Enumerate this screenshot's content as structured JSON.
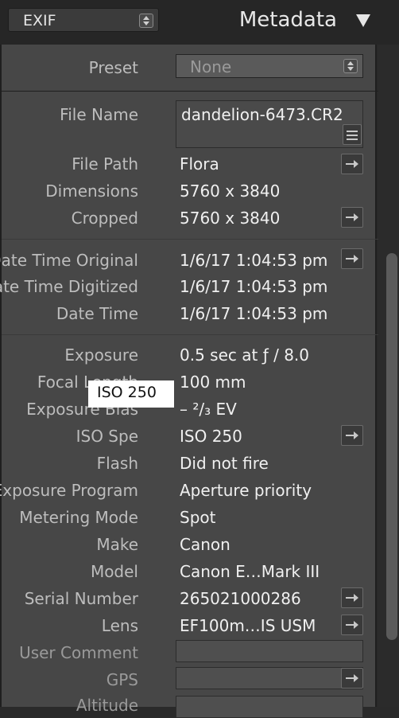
{
  "header": {
    "preset_select": "EXIF",
    "title": "Metadata"
  },
  "preset": {
    "label": "Preset",
    "value": "None"
  },
  "file": {
    "file_name_label": "File Name",
    "file_name_value": "dandelion-6473.CR2",
    "file_path_label": "File Path",
    "file_path_value": "Flora",
    "dimensions_label": "Dimensions",
    "dimensions_value": "5760 x 3840",
    "cropped_label": "Cropped",
    "cropped_value": "5760 x 3840"
  },
  "dates": {
    "original_label": "Date Time Original",
    "original_value": "1/6/17 1:04:53 pm",
    "digitized_label": "Date Time Digitized",
    "digitized_value": "1/6/17 1:04:53 pm",
    "datetime_label": "Date Time",
    "datetime_value": "1/6/17 1:04:53 pm"
  },
  "exif": {
    "exposure_label": "Exposure",
    "exposure_value": "0.5 sec at ƒ / 8.0",
    "focal_label": "Focal Length",
    "focal_value": "100 mm",
    "bias_label": "Exposure Bias",
    "bias_value": "– ²/₃ EV",
    "iso_label": "ISO Spe",
    "iso_value": "ISO 250",
    "flash_label": "Flash",
    "flash_value": "Did not fire",
    "program_label": "Exposure Program",
    "program_value": "Aperture priority",
    "metering_label": "Metering Mode",
    "metering_value": "Spot",
    "make_label": "Make",
    "make_value": "Canon",
    "model_label": "Model",
    "model_value": "Canon E…Mark III",
    "serial_label": "Serial Number",
    "serial_value": "265021000286",
    "lens_label": "Lens",
    "lens_value": "EF100m…IS USM",
    "comment_label": "User Comment",
    "comment_value": "",
    "gps_label": "GPS",
    "gps_value": "",
    "altitude_label": "Altitude"
  },
  "tooltip": {
    "text": "ISO 250"
  }
}
